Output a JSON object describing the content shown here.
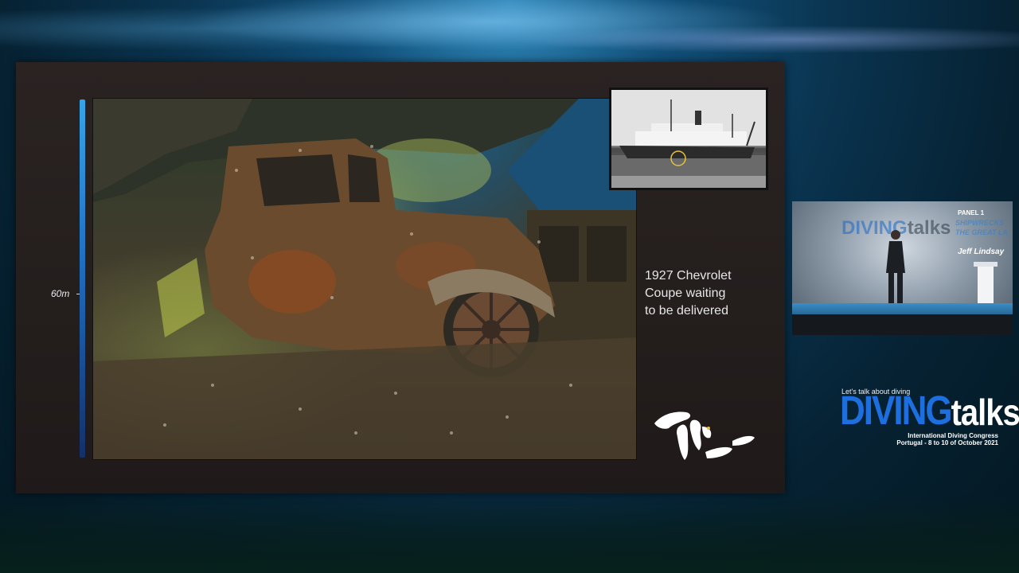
{
  "slide": {
    "depth_label": "60m",
    "caption_lines": [
      "1927 Chevrolet",
      "Coupe waiting",
      "to be delivered"
    ]
  },
  "presenter_video": {
    "backdrop_logo_a": "DIVING",
    "backdrop_logo_b": "talks",
    "panel_label": "PANEL 1",
    "panel_title_1": "SHIPWRECKS",
    "panel_title_2": "THE GREAT LA",
    "speaker_name": "Jeff Lindsay"
  },
  "logo": {
    "tagline": "Let's talk about diving",
    "word_a": "DIVING",
    "word_b": "talks",
    "line1": "International Diving Congress",
    "line2": "Portugal - 8 to 10 of October 2021"
  },
  "colors": {
    "brand_blue": "#1d6fe0",
    "depth_bar_top": "#36a5e8",
    "depth_bar_bottom": "#13306a"
  }
}
